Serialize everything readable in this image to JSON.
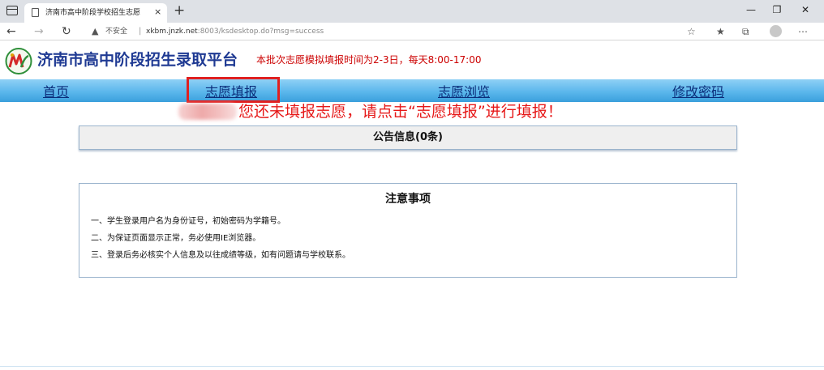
{
  "browser": {
    "tab_title": "济南市高中阶段学校招生志愿",
    "tab_close": "×",
    "new_tab": "+",
    "security_label": "不安全",
    "url_host": "xkbm.jnzk.net",
    "url_rest": ":8003/ksdesktop.do?msg=success",
    "icons": {
      "menu": "window-menu-icon",
      "page": "page-icon",
      "back": "back-arrow-icon",
      "forward": "forward-arrow-icon",
      "reload": "reload-icon",
      "warning": "warning-icon",
      "read_aloud": "read-aloud-icon",
      "favorites": "favorites-icon",
      "collections": "collections-icon",
      "profile": "profile-avatar-icon",
      "more": "more-icon"
    }
  },
  "site": {
    "title": "济南市高中阶段招生录取平台",
    "notice": "本批次志愿模拟填报时间为2-3日，每天8:00-17:00",
    "notice_color": "#cc0000"
  },
  "nav": {
    "items": [
      {
        "label": "首页"
      },
      {
        "label": "志愿填报"
      },
      {
        "label": "志愿浏览"
      },
      {
        "label": "修改密码"
      }
    ],
    "highlight_color": "#e02020"
  },
  "prompt": {
    "text": "您还未填报志愿，请点击“志愿填报”进行填报！",
    "color": "#e61818"
  },
  "announcement": {
    "title": "公告信息(0条)"
  },
  "notes": {
    "title": "注意事项",
    "lines": [
      "一、学生登录用户名为身份证号，初始密码为学籍号。",
      "二、为保证页面显示正常，务必使用IE浏览器。",
      "三、登录后务必核实个人信息及以往成绩等级，如有问题请与学校联系。"
    ]
  }
}
